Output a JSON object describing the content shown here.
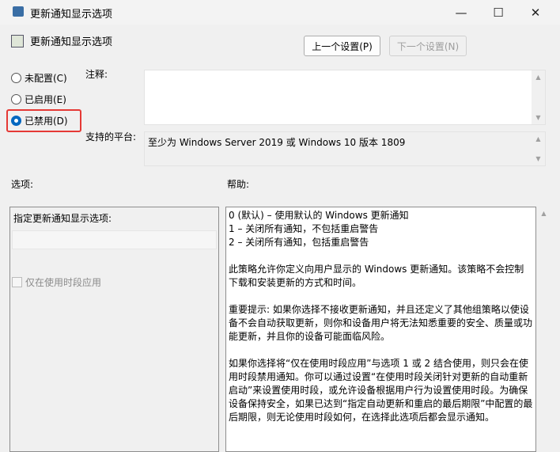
{
  "window": {
    "title": "更新通知显示选项",
    "minimize": "—",
    "maximize": "☐",
    "close": "✕"
  },
  "header": {
    "policy_name": "更新通知显示选项",
    "prev_button": "上一个设置(P)",
    "next_button": "下一个设置(N)"
  },
  "state": {
    "options": [
      {
        "label": "未配置(C)",
        "selected": false
      },
      {
        "label": "已启用(E)",
        "selected": false
      },
      {
        "label": "已禁用(D)",
        "selected": true
      }
    ]
  },
  "comment": {
    "label": "注释:",
    "value": ""
  },
  "platform": {
    "label": "支持的平台:",
    "value": "至少为 Windows Server 2019 或 Windows 10 版本 1809"
  },
  "options_section": {
    "label": "选项:",
    "field_label": "指定更新通知显示选项:",
    "checkbox_label": "仅在使用时段应用"
  },
  "help_section": {
    "label": "帮助:",
    "paragraphs": [
      [
        "0 (默认) – 使用默认的 Windows 更新通知",
        "1 – 关闭所有通知，不包括重启警告",
        "2 – 关闭所有通知，包括重启警告"
      ],
      [
        "此策略允许你定义向用户显示的 Windows 更新通知。该策略不会控制",
        "下载和安装更新的方式和时间。"
      ],
      [
        "重要提示: 如果你选择不接收更新通知，并且还定义了其他组策略以使设",
        "备不会自动获取更新，则你和设备用户将无法知悉重要的安全、质量或功",
        "能更新，并且你的设备可能面临风险。"
      ],
      [
        "如果你选择将“仅在使用时段应用”与选项 1 或 2 结合使用，则只会在使",
        "用时段禁用通知。你可以通过设置“在使用时段关闭针对更新的自动重新",
        "启动”来设置使用时段，或允许设备根据用户行为设置使用时段。为确保",
        "设备保持安全，如果已达到“指定自动更新和重启的最后期限”中配置的最",
        "后期限，则无论使用时段如何，在选择此选项后都会显示通知。"
      ]
    ]
  },
  "colors": {
    "accent": "#0067c0",
    "highlight": "#e53935"
  }
}
